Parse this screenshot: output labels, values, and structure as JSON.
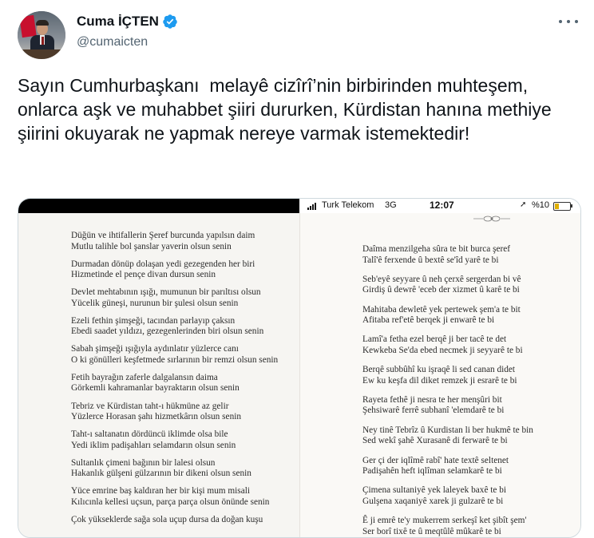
{
  "tweet": {
    "display_name": "Cuma İÇTEN",
    "handle": "@cumaicten",
    "verified_icon": "verified-badge-icon",
    "more_icon": "more-options-icon",
    "text": "Sayın Cumhurbaşkanı  melayê cizîrî’nin birbirinden muhteşem,  onlarca aşk ve muhabbet şiiri dururken, Kürdistan hanına methiye şiirini okuyarak ne yapmak nereye varmak istemektedir!"
  },
  "image": {
    "status_bar": {
      "carrier": "Turk Telekom",
      "network": "3G",
      "time": "12:07",
      "battery": "%10"
    },
    "left_page_stanzas": [
      [
        "Düğün ve ihtifallerin Şeref burcunda yapılsın daim",
        "Mutlu talihle bol şanslar yaverin olsun senin"
      ],
      [
        "Durmadan dönüp dolaşan yedi gezegenden her biri",
        "Hizmetinde el pençe divan dursun senin"
      ],
      [
        "Devlet mehtabının ışığı, mumunun bir parıltısı olsun",
        "Yücelik güneşi, nurunun bir şulesi olsun senin"
      ],
      [
        "Ezeli fethin şimşeği, tacından parlayıp çaksın",
        "Ebedi saadet yıldızı, gezegenlerinden biri olsun senin"
      ],
      [
        "Sabah şimşeği ışığıyla aydınlatır yüzlerce canı",
        "O ki gönülleri keşfetmede sırlarının bir remzi olsun senin"
      ],
      [
        "Fetih bayrağın zaferle dalgalansın daima",
        "Görkemli kahramanlar bayraktarın olsun senin"
      ],
      [
        "Tebriz ve Kürdistan taht-ı hükmüne az gelir",
        "Yüzlerce Horasan şahı hizmetkârın olsun senin"
      ],
      [
        "Taht-ı saltanatın dördüncü iklimde olsa bile",
        "Yedi iklim padişahları selamdarın olsun senin"
      ],
      [
        "Sultanlık çimeni bağının bir lalesi olsun",
        "Hakanlık gülşeni gülzarının bir dikeni olsun senin"
      ],
      [
        "Yüce emrine baş kaldıran her bir kişi mum misali",
        "Kılıcınla kellesi uçsun, parça parça olsun önünde senin"
      ],
      [
        "Çok yükseklerde sağa sola uçup dursa da doğan kuşu"
      ]
    ],
    "right_page_stanzas": [
      [
        "Daîma menzilgeha sûra te bit burca şeref",
        "Talî'ê ferxende û bextê se'îd yarê te bi"
      ],
      [
        "Seb'eyê seyyare û neh çerxê sergerdan bi vê",
        "Girdiş û dewrê 'eceb der xizmet û karê te bi"
      ],
      [
        "Mahitaba dewletê yek pertewek şem'a te bit",
        "Afitaba ref'etê berqek ji enwarê te bi"
      ],
      [
        "Lamî'a fetha ezel berqê ji ber tacê te det",
        "Kewkeba Se'da ebed necmek ji seyyarê te bi"
      ],
      [
        "Berqê subbûhî ku işraqê li sed canan didet",
        "Ew ku keşfa dil diket remzek ji esrarê te bi"
      ],
      [
        "Rayeta fethê ji nesra te her menşûri bit",
        "Şehsiwarê ferrê subhanî 'elemdarê te bi"
      ],
      [
        "Ney tinê Tebrîz û Kurdistan li ber hukmê te bin",
        "Sed wekî şahê Xurasanê di ferwarê te bi"
      ],
      [
        "Ger çi der iqlîmê rabî' hate textê seltenet",
        "Padişahên heft iqlîman selamkarê te bi"
      ],
      [
        "Çimena sultaniyê yek laleyek baxê te bi",
        "Gulşena xaqaniyê xarek ji gulzarê te bi"
      ],
      [
        "Ê ji emrê te'y mukerrem serkeşî ket şibît şem'",
        "Ser borî tixê te û meqtûlê mûkarê te bi"
      ]
    ]
  }
}
